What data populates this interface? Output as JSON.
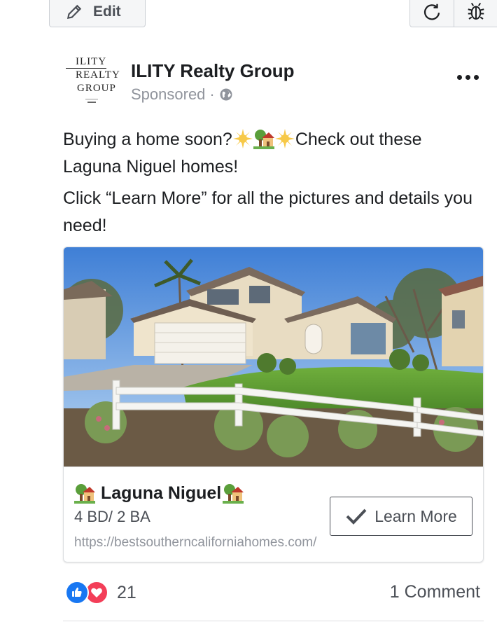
{
  "toolbar": {
    "edit_label": "Edit",
    "edit_icon": "pencil-icon",
    "refresh_icon": "refresh-icon",
    "bug_icon": "bug-icon"
  },
  "post": {
    "page_name": "ILITY Realty Group",
    "sponsored_label": "Sponsored",
    "separator": "·",
    "audience_icon": "globe-icon",
    "logo": {
      "line1": "ILITY",
      "line2": "REALTY",
      "line3": "GROUP"
    },
    "text": {
      "line1_start": "Buying a home soon?",
      "line1_end": "Check out these",
      "line2": "Laguna Niguel homes!",
      "paragraph2": "Click “Learn More” for all the pictures and details you need!"
    }
  },
  "card": {
    "title": "Laguna Niguel",
    "description": "4 BD/ 2 BA",
    "url": "https://bestsoutherncaliforniahomes.com/",
    "cta_label": "Learn More",
    "cta_icon": "checkmark-icon"
  },
  "engagement": {
    "reaction_count": "21",
    "comments_label": "1 Comment"
  },
  "colors": {
    "like_blue": "#1877f2",
    "love_red": "#f33e58",
    "text_dark": "#1c1e21",
    "text_muted": "#90949c"
  }
}
